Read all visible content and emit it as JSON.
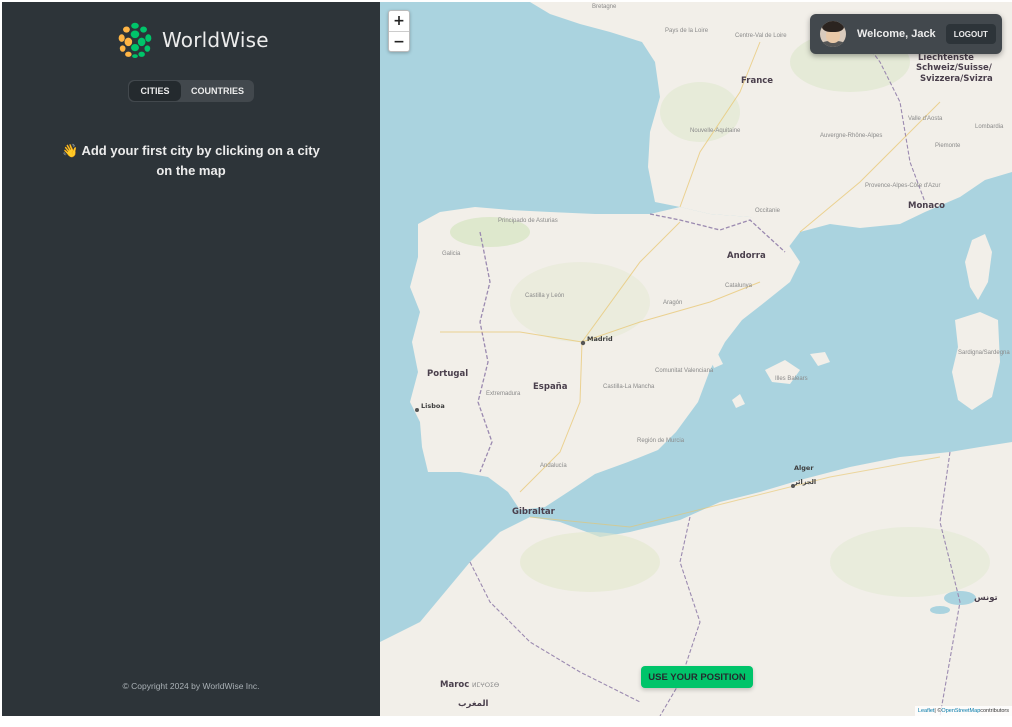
{
  "sidebar": {
    "logo_text": "WorldWise",
    "tabs": [
      {
        "label": "CITIES",
        "active": true
      },
      {
        "label": "COUNTRIES",
        "active": false
      }
    ],
    "message_emoji": "👋",
    "message": "Add your first city by clicking on a city on the map",
    "copyright": "© Copyright 2024 by WorldWise Inc."
  },
  "map": {
    "zoom_in": "+",
    "zoom_out": "−",
    "user": {
      "welcome": "Welcome, Jack",
      "logout": "LOGOUT"
    },
    "use_position": "USE YOUR POSITION",
    "attribution": {
      "leaflet": "Leaflet",
      "separator": " | © ",
      "osm": "OpenStreetMap",
      "suffix": " contributors"
    },
    "labels": {
      "france": "France",
      "andorra": "Andorra",
      "monaco": "Monaco",
      "portugal": "Portugal",
      "espana": "España",
      "madrid": "Madrid",
      "lisboa": "Lisboa",
      "gibraltar": "Gibraltar",
      "alger": "Alger",
      "alger_ar": "الجزائر",
      "maroc": "Maroc",
      "maroc_tif": "ⵍⵎⵖⵔⵉⴱ",
      "maroc_ar": "المغرب",
      "tunisia_ar": "تونس",
      "swiss_1": "Liechtenste",
      "swiss_2": "Schweiz/Suisse/",
      "swiss_3": "Svizzera/Svizra",
      "bretagne": "Bretagne",
      "pays_loire": "Pays de la Loire",
      "centre": "Centre-Val de Loire",
      "nouvelle": "Nouvelle-Aquitaine",
      "auvergne": "Auvergne-Rhône-Alpes",
      "occitanie": "Occitanie",
      "provence": "Provence-Alpes-Côte d'Azur",
      "asturias": "Principado de Asturias",
      "galicia": "Galicia",
      "castilla_leon": "Castilla y León",
      "aragon": "Aragón",
      "cataluna": "Catalunya",
      "extremadura": "Extremadura",
      "castilla_mancha": "Castilla-La Mancha",
      "valenciana": "Comunitat Valenciana",
      "murcia": "Región de Murcia",
      "andalucia": "Andalucía",
      "baleares": "Illes Balears",
      "sardegna": "Sardigna/Sardegna",
      "piemonte": "Piemonte",
      "lombardia": "Lombardia",
      "valle_aosta": "Valle d'Aosta"
    }
  },
  "colors": {
    "sidebar_bg": "#2d3439",
    "panel_bg": "#42484d",
    "accent_green": "#00c46a",
    "text_light": "#ececec",
    "sea": "#aad3df",
    "land": "#f2efe9"
  }
}
